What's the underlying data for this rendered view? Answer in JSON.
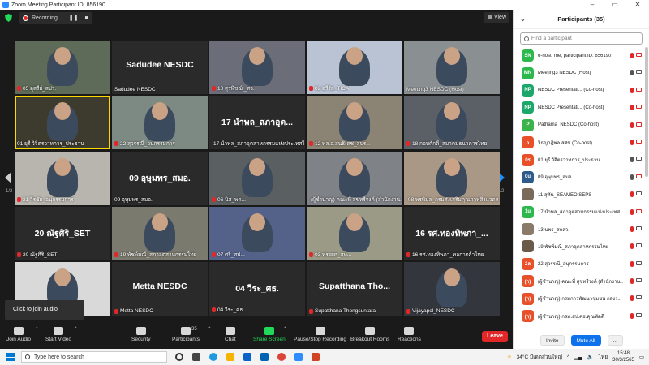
{
  "window": {
    "title": "Zoom Meeting Participant ID: 856190",
    "controls": [
      "–",
      "▭",
      "✕"
    ]
  },
  "topbar": {
    "recording_label": "Recording...",
    "view_label": "View"
  },
  "pager": {
    "left": "1/2",
    "right": "1/2"
  },
  "tiles": [
    {
      "label": "05 อุสรีย์_สปร.",
      "big": "",
      "kind": "video",
      "muted": true
    },
    {
      "label": "Sadudee NESDC",
      "big": "Sadudee NESDC",
      "kind": "name",
      "muted": false
    },
    {
      "label": "10 สุรพิชฌ์ _สจ.",
      "big": "",
      "kind": "video",
      "muted": true
    },
    {
      "label": "02 อรีรัย_TICA",
      "big": "",
      "kind": "video",
      "muted": true
    },
    {
      "label": "Meeting3 NESDC (Host)",
      "big": "",
      "kind": "video",
      "muted": false
    },
    {
      "label": "01 ยุรี วิจิตรวาทการ_ประธาน",
      "big": "",
      "kind": "video",
      "muted": false,
      "active": true
    },
    {
      "label": "22 สุวรรณี_อนุกรรมการ",
      "big": "",
      "kind": "video",
      "muted": true
    },
    {
      "label": "17 นำพล_สภาอุตสาหกรรมแห่งประเทศไทย",
      "big": "17 นำพล_สภาอุต...",
      "kind": "name",
      "muted": true
    },
    {
      "label": "12 พล.อ.สนธิเดช_สปร...",
      "big": "",
      "kind": "video",
      "muted": true
    },
    {
      "label": "18 กอบศักดิ์_สมาคมธนาคารไทย",
      "big": "",
      "kind": "video",
      "muted": true
    },
    {
      "label": "21 วีรชัย_อนุกรรมการ",
      "big": "",
      "kind": "video",
      "muted": true
    },
    {
      "label": "09 อุษุมพร_สมอ.",
      "big": "09 อุษุมพร_สมอ.",
      "kind": "name",
      "muted": false
    },
    {
      "label": "06 นิส_พด...",
      "big": "",
      "kind": "video",
      "muted": true
    },
    {
      "label": "(ผู้ชำนาญ) คณะพี่ สุขทรีรงค์ (สำนักงาน...",
      "big": "",
      "kind": "video",
      "muted": true
    },
    {
      "label": "08 พรพิมล_กรมส่งเสริมคุณภาพสิ่งแวดล...",
      "big": "",
      "kind": "video",
      "muted": true
    },
    {
      "label": "20 ณัฐศิริ_SET",
      "big": "20 ณัฐศิริ_SET",
      "kind": "name",
      "muted": true
    },
    {
      "label": "19 พัชพ์มณี_สภาอุตสาหกรรมไทย",
      "big": "",
      "kind": "video",
      "muted": true
    },
    {
      "label": "07 ศรี_สป...",
      "big": "",
      "kind": "video",
      "muted": true
    },
    {
      "label": "03 ทรงยศ_สท...",
      "big": "",
      "kind": "video",
      "muted": true
    },
    {
      "label": "16 รศ.ทองทิพภา_หอการค้าไทย",
      "big": "16 รศ.ทองทิพภา_...",
      "kind": "name",
      "muted": true
    },
    {
      "label": "",
      "big": "",
      "kind": "video",
      "muted": false
    },
    {
      "label": "Metta NESDC",
      "big": "Metta NESDC",
      "kind": "name",
      "muted": true
    },
    {
      "label": "04 วีระ_ศธ.",
      "big": "04 วีระ_ศธ.",
      "kind": "name",
      "muted": true
    },
    {
      "label": "Supatthana Thongsuntara",
      "big": "Supatthana Tho...",
      "kind": "name",
      "muted": true
    },
    {
      "label": "Vijayapol_NESDC",
      "big": "",
      "kind": "video",
      "muted": true
    }
  ],
  "tooltip": {
    "join_audio": "Click to join audio"
  },
  "toolbar": {
    "join_audio": "Join Audio",
    "start_video": "Start Video",
    "security": "Security",
    "participants": "Participants",
    "participants_count": "35",
    "chat": "Chat",
    "share_screen": "Share Screen",
    "pause_recording": "Pause/Stop Recording",
    "breakout_rooms": "Breakout Rooms",
    "reactions": "Reactions",
    "leave": "Leave"
  },
  "panel": {
    "title": "Participants (35)",
    "search_placeholder": "Find a participant",
    "participants": [
      {
        "initials": "SN",
        "color": "#2db84d",
        "name": "o-host, me, participant ID: 856190)",
        "video": false,
        "mic": false
      },
      {
        "initials": "MN",
        "color": "#2db84d",
        "name": "Meeting3 NESDC (Host)",
        "video": true,
        "mic": true
      },
      {
        "initials": "NP",
        "color": "#1ca76b",
        "name": "NESDC Presentati... (Co-host)",
        "video": false,
        "mic": false
      },
      {
        "initials": "NP",
        "color": "#1ca76b",
        "name": "NESDC Presentati... (Co-host)",
        "video": false,
        "mic": false
      },
      {
        "initials": "P",
        "color": "#3bb34a",
        "name": "Pathama_NESDC (Co-host)",
        "video": false,
        "mic": false
      },
      {
        "initials": "ว",
        "color": "#e8502a",
        "name": "วิธญาฎิพล สศช (Co-host)",
        "video": false,
        "mic": false
      },
      {
        "initials": "0ร",
        "color": "#e8502a",
        "name": "01 ยุรี วิจิตรวาทการ_ประธาน",
        "video": true,
        "mic": true
      },
      {
        "initials": "0u",
        "color": "#2e5c8a",
        "name": "09 อุษุมพร_สมอ.",
        "video": false,
        "mic": true
      },
      {
        "initials": "",
        "color": "#7a6a5a",
        "name": "11 สุทัน_SEAMEO SEPS",
        "video": true,
        "mic": false
      },
      {
        "initials": "1u",
        "color": "#2db84d",
        "name": "17 นำพล_สภาอุตสาหกรรมแห่งประเทศ...",
        "video": false,
        "mic": false
      },
      {
        "initials": "",
        "color": "#8a7a6a",
        "name": "13 นพร_สกสว.",
        "video": true,
        "mic": false
      },
      {
        "initials": "",
        "color": "#6a5a4a",
        "name": "19 พัชพ์มณี_สภาอุตสาหกรรมไทย",
        "video": true,
        "mic": false
      },
      {
        "initials": "2ล",
        "color": "#e8502a",
        "name": "22 สุวรรณี_อนุกรรมการ",
        "video": true,
        "mic": false
      },
      {
        "initials": "(ก)",
        "color": "#e8502a",
        "name": "(ผู้ชำนาญ) คณะพี่ สุขทรีรงค์ (สำนักงาน...",
        "video": true,
        "mic": false
      },
      {
        "initials": "(ก)",
        "color": "#e8502a",
        "name": "(ผู้ชำนาญ) กรมการพัฒนาชุมชน กองร...",
        "video": true,
        "mic": false
      },
      {
        "initials": "(ก)",
        "color": "#e8502a",
        "name": "(ผู้ชำนาญ) กสภ.สป.ศธ.คุณพัดดี",
        "video": true,
        "mic": false
      }
    ],
    "invite": "Invite",
    "mute_all": "Mute All",
    "more": "..."
  },
  "taskbar": {
    "search_placeholder": "Type here to search",
    "weather": "34°C มีเดดส่วนใหญ่",
    "lang": "ไทย",
    "time": "15:48",
    "date": "30/3/2565"
  }
}
